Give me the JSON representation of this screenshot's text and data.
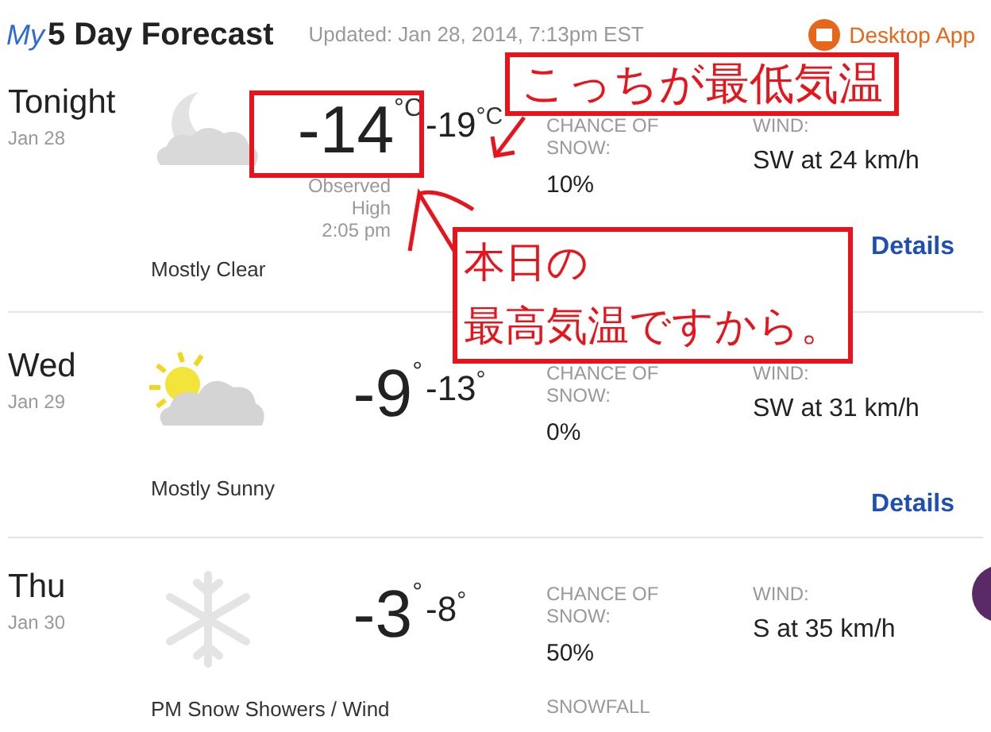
{
  "header": {
    "logo": "My",
    "title": "5 Day Forecast",
    "updated": "Updated: Jan 28, 2014, 7:13pm EST",
    "app_link": "Desktop App"
  },
  "days": [
    {
      "day": "Tonight",
      "date": "Jan 28",
      "kind": "moon-cloud",
      "condition": "Mostly Clear",
      "high": "-14",
      "high_unit": "°C",
      "low": "-19",
      "low_unit": "°C",
      "observed": [
        "Observed",
        "High",
        "2:05 pm"
      ],
      "chance_label": "CHANCE OF SNOW:",
      "chance": "10%",
      "wind_label": "WIND:",
      "wind": "SW at 24 km/h",
      "details": "Details"
    },
    {
      "day": "Wed",
      "date": "Jan 29",
      "kind": "sun-cloud",
      "condition": "Mostly Sunny",
      "high": "-9",
      "high_unit": "°",
      "low": "-13",
      "low_unit": "°",
      "chance_label": "CHANCE OF SNOW:",
      "chance": "0%",
      "wind_label": "WIND:",
      "wind": "SW at 31 km/h",
      "details": "Details"
    },
    {
      "day": "Thu",
      "date": "Jan 30",
      "kind": "snow",
      "condition": "PM Snow Showers / Wind",
      "high": "-3",
      "high_unit": "°",
      "low": "-8",
      "low_unit": "°",
      "chance_label": "CHANCE OF SNOW:",
      "chance": "50%",
      "wind_label": "WIND:",
      "wind": "S at 35 km/h",
      "extra_label": "SNOWFALL"
    }
  ],
  "annotations": {
    "low_note": "こっちが最低気温",
    "high_note": [
      "本日の",
      "最高気温ですから。"
    ]
  }
}
